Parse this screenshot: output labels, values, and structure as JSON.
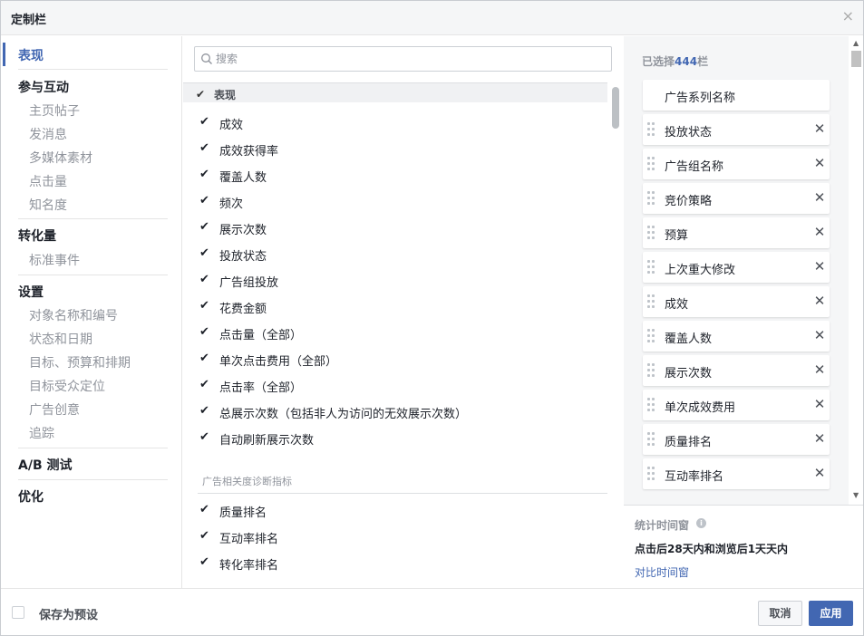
{
  "dialog": {
    "title": "定制栏",
    "close_icon": "×"
  },
  "nav": {
    "sections": [
      {
        "label": "表现",
        "active": true,
        "items": []
      },
      {
        "label": "参与互动",
        "items": [
          "主页帖子",
          "发消息",
          "多媒体素材",
          "点击量",
          "知名度"
        ]
      },
      {
        "label": "转化量",
        "items": [
          "标准事件"
        ]
      },
      {
        "label": "设置",
        "items": [
          "对象名称和编号",
          "状态和日期",
          "目标、预算和排期",
          "目标受众定位",
          "广告创意",
          "追踪"
        ]
      },
      {
        "label": "A/B 测试",
        "items": []
      },
      {
        "label": "优化",
        "items": []
      }
    ]
  },
  "search": {
    "placeholder": "搜索"
  },
  "metrics": {
    "header_label": "表现",
    "performance": [
      {
        "label": "成效",
        "checked": true
      },
      {
        "label": "成效获得率",
        "checked": true
      },
      {
        "label": "覆盖人数",
        "checked": true
      },
      {
        "label": "频次",
        "checked": true
      },
      {
        "label": "展示次数",
        "checked": true
      },
      {
        "label": "投放状态",
        "checked": true
      },
      {
        "label": "广告组投放",
        "checked": true
      },
      {
        "label": "花费金额",
        "checked": true
      },
      {
        "label": "点击量（全部）",
        "checked": true
      },
      {
        "label": "单次点击费用（全部）",
        "checked": true
      },
      {
        "label": "点击率（全部）",
        "checked": true
      },
      {
        "label": "总展示次数（包括非人为访问的无效展示次数）",
        "checked": true
      },
      {
        "label": "自动刷新展示次数",
        "checked": true
      }
    ],
    "diagnostics_header": "广告相关度诊断指标",
    "diagnostics": [
      {
        "label": "质量排名",
        "checked": true
      },
      {
        "label": "互动率排名",
        "checked": true
      },
      {
        "label": "转化率排名",
        "checked": true
      }
    ]
  },
  "selected": {
    "count_prefix": "已选择",
    "count": "444",
    "count_suffix": "栏",
    "columns": [
      {
        "label": "广告系列名称",
        "locked": true
      },
      {
        "label": "投放状态"
      },
      {
        "label": "广告组名称"
      },
      {
        "label": "竞价策略"
      },
      {
        "label": "预算"
      },
      {
        "label": "上次重大修改"
      },
      {
        "label": "成效"
      },
      {
        "label": "覆盖人数"
      },
      {
        "label": "展示次数"
      },
      {
        "label": "单次成效费用"
      },
      {
        "label": "质量排名"
      },
      {
        "label": "互动率排名"
      }
    ],
    "remove_icon": "✕"
  },
  "attribution": {
    "label": "统计时间窗",
    "info_icon": "i",
    "value": "点击后28天内和浏览后1天天内",
    "link": "对比时间窗"
  },
  "footer": {
    "save_preset_label": "保存为预设",
    "cancel_label": "取消",
    "apply_label": "应用"
  },
  "colors": {
    "accent": "#4267b2",
    "muted": "#90949c",
    "panel_bg": "#f5f6f7"
  }
}
